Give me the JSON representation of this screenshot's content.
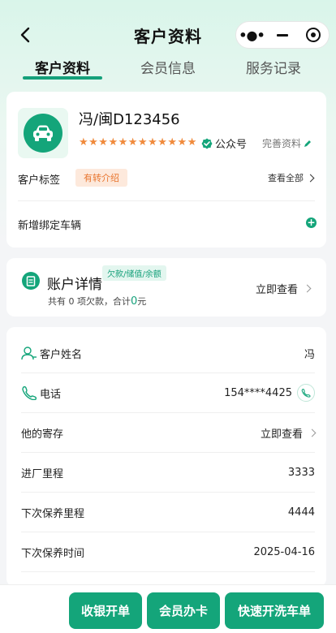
{
  "header": {
    "title": "客户资料"
  },
  "tabs": [
    {
      "label": "客户资料",
      "active": true
    },
    {
      "label": "会员信息",
      "active": false
    },
    {
      "label": "服务记录",
      "active": false
    }
  ],
  "customer_card": {
    "plate": "冯/闽D123456",
    "stars": "★★★★★★★★★★★★",
    "wechat_label": "公众号",
    "complete_label": "完善资料",
    "tag_label": "客户标签",
    "tag_chip": "有转介绍",
    "view_all_label": "查看全部",
    "add_vehicle_label": "新增绑定车辆"
  },
  "account": {
    "title": "账户详情",
    "badge": "欠款/储值/余额",
    "sub_prefix": "共有 0 项欠款，合计",
    "amount": "0",
    "unit": "元",
    "link": "立即查看"
  },
  "info_rows": {
    "name": {
      "label": "客户姓名",
      "value": "冯"
    },
    "phone": {
      "label": "电话",
      "value": "154****4425"
    },
    "storage": {
      "label": "他的寄存",
      "value": "立即查看"
    },
    "mileage": {
      "label": "进厂里程",
      "value": "3333"
    },
    "next_mileage": {
      "label": "下次保养里程",
      "value": "4444"
    },
    "next_date": {
      "label": "下次保养时间",
      "value": "2025-04-16"
    }
  },
  "actions": {
    "checkout": "收银开单",
    "member_card": "会员办卡",
    "quick_wash": "快速开洗车单"
  },
  "colors": {
    "primary": "#14a57a",
    "star": "#f08a3c",
    "tag": "#e8752e"
  }
}
